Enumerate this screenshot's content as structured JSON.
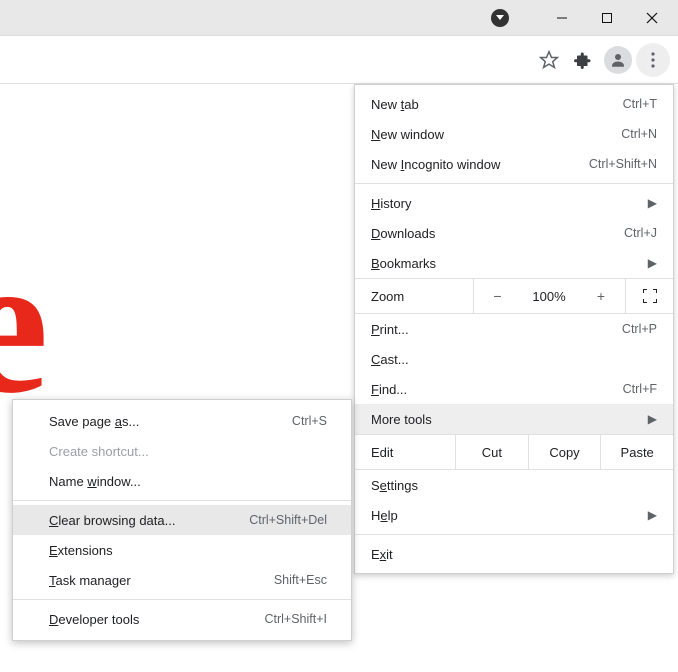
{
  "titlebar": {
    "minimize": "–",
    "maximize": "▢",
    "close": "✕"
  },
  "toolbar": {
    "star": "star-icon",
    "puzzle": "extensions-icon",
    "profile": "profile-icon",
    "kebab": "more-icon"
  },
  "menu": {
    "new_tab": {
      "pre": "New ",
      "u": "t",
      "post": "ab",
      "sc": "Ctrl+T"
    },
    "new_window": {
      "pre": "",
      "u": "N",
      "post": "ew window",
      "sc": "Ctrl+N"
    },
    "incognito": {
      "pre": "New ",
      "u": "I",
      "post": "ncognito window",
      "sc": "Ctrl+Shift+N"
    },
    "history": {
      "pre": "",
      "u": "H",
      "post": "istory"
    },
    "downloads": {
      "pre": "",
      "u": "D",
      "post": "ownloads",
      "sc": "Ctrl+J"
    },
    "bookmarks": {
      "pre": "",
      "u": "B",
      "post": "ookmarks"
    },
    "zoom": {
      "label": "Zoom",
      "minus": "−",
      "pct": "100%",
      "plus": "+"
    },
    "print": {
      "pre": "",
      "u": "P",
      "post": "rint...",
      "sc": "Ctrl+P"
    },
    "cast": {
      "pre": "",
      "u": "C",
      "post": "ast..."
    },
    "find": {
      "pre": "",
      "u": "F",
      "post": "ind...",
      "sc": "Ctrl+F"
    },
    "more_tools": {
      "label": "More tools"
    },
    "edit": {
      "label": "Edit",
      "cut": "Cut",
      "copy": "Copy",
      "paste": "Paste"
    },
    "settings": {
      "pre": "S",
      "u": "e",
      "post": "ttings"
    },
    "help": {
      "pre": "H",
      "u": "e",
      "post": "lp"
    },
    "exit": {
      "pre": "E",
      "u": "x",
      "post": "it"
    }
  },
  "submenu": {
    "save_as": {
      "pre": "Save page ",
      "u": "a",
      "post": "s...",
      "sc": "Ctrl+S"
    },
    "create_shortcut": {
      "label": "Create shortcut..."
    },
    "name_window": {
      "pre": "Name ",
      "u": "w",
      "post": "indow..."
    },
    "clear_data": {
      "pre": "",
      "u": "C",
      "post": "lear browsing data...",
      "sc": "Ctrl+Shift+Del"
    },
    "extensions": {
      "pre": "",
      "u": "E",
      "post": "xtensions"
    },
    "task_manager": {
      "pre": "",
      "u": "T",
      "post": "ask manager",
      "sc": "Shift+Esc"
    },
    "dev_tools": {
      "pre": "",
      "u": "D",
      "post": "eveloper tools",
      "sc": "Ctrl+Shift+I"
    }
  },
  "page_artifact": "e"
}
